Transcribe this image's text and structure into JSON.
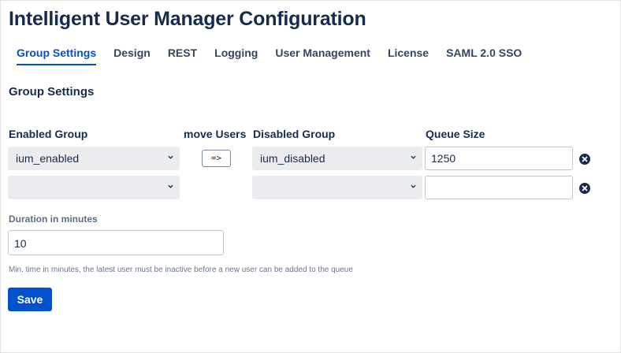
{
  "page": {
    "title": "Intelligent User Manager Configuration"
  },
  "tabs": [
    {
      "label": "Group Settings",
      "active": true
    },
    {
      "label": "Design",
      "active": false
    },
    {
      "label": "REST",
      "active": false
    },
    {
      "label": "Logging",
      "active": false
    },
    {
      "label": "User Management",
      "active": false
    },
    {
      "label": "License",
      "active": false
    },
    {
      "label": "SAML 2.0 SSO",
      "active": false
    }
  ],
  "section": {
    "title": "Group Settings"
  },
  "columns": {
    "enabled_group": "Enabled Group",
    "move_users": "move Users",
    "disabled_group": "Disabled Group",
    "queue_size": "Queue Size"
  },
  "rows": [
    {
      "enabled_group": "ium_enabled",
      "move_label": "=>",
      "disabled_group": "ium_disabled",
      "queue_size": "1250"
    },
    {
      "enabled_group": "",
      "disabled_group": "",
      "queue_size": ""
    }
  ],
  "duration": {
    "label": "Duration in minutes",
    "value": "10",
    "help": "Min. time in minutes, the latest user must be inactive before a new user can be added to the queue"
  },
  "actions": {
    "save_label": "Save"
  },
  "colors": {
    "accent": "#0052cc",
    "text": "#172b4d",
    "select_bg": "#ebecf0"
  },
  "icons": {
    "chevron": "chevron-down-icon",
    "remove": "remove-row-icon"
  }
}
